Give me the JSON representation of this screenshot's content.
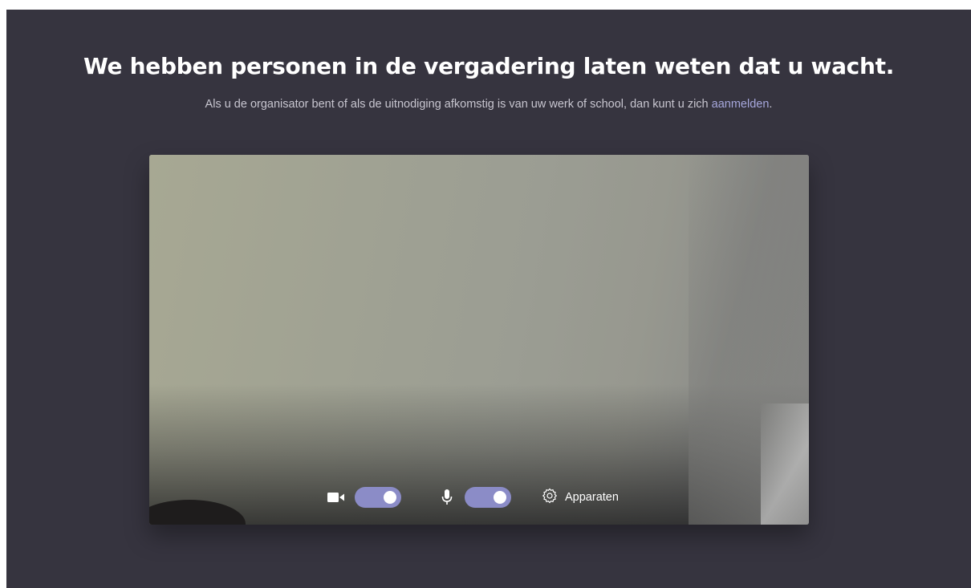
{
  "lobby": {
    "title": "We hebben personen in de vergadering laten weten dat u wacht.",
    "subtitle_prefix": "Als u de organisator bent of als de uitnodiging afkomstig is van uw werk of school, dan kunt u zich ",
    "signin_link": "aanmelden",
    "subtitle_suffix": "."
  },
  "controls": {
    "camera": {
      "icon": "video-camera-icon",
      "enabled": true
    },
    "microphone": {
      "icon": "microphone-icon",
      "enabled": true
    },
    "devices": {
      "icon": "gear-icon",
      "label": "Apparaten"
    }
  },
  "colors": {
    "background": "#36343f",
    "accent": "#8b8cc7",
    "link": "#a6a7dc"
  }
}
